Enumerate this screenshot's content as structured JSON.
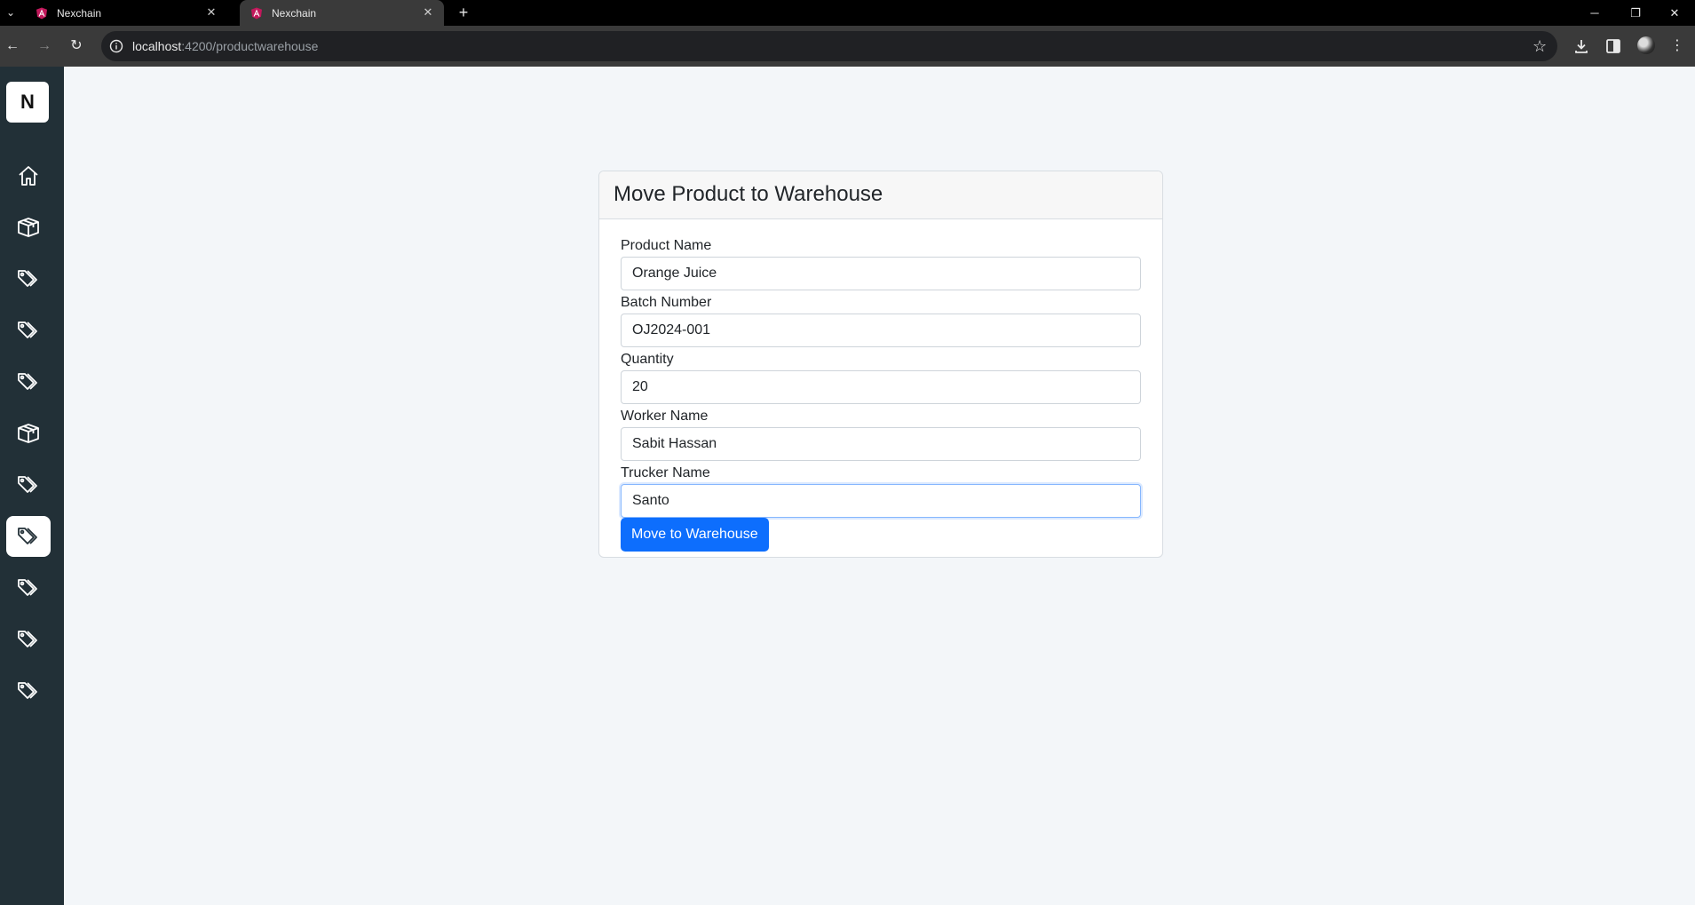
{
  "browser": {
    "tabs": [
      {
        "title": "Nexchain",
        "active": false
      },
      {
        "title": "Nexchain",
        "active": true
      }
    ],
    "url_host": "localhost",
    "url_path": ":4200/productwarehouse"
  },
  "sidebar": {
    "logo": "N",
    "items": [
      {
        "icon": "home-icon",
        "active": false
      },
      {
        "icon": "box-icon",
        "active": false
      },
      {
        "icon": "tag-icon",
        "active": false
      },
      {
        "icon": "tag-icon",
        "active": false
      },
      {
        "icon": "tag-icon",
        "active": false
      },
      {
        "icon": "box-icon",
        "active": false
      },
      {
        "icon": "tag-icon",
        "active": false
      },
      {
        "icon": "tag-icon",
        "active": true
      },
      {
        "icon": "tag-icon",
        "active": false
      },
      {
        "icon": "tag-icon",
        "active": false
      },
      {
        "icon": "tag-icon",
        "active": false
      }
    ]
  },
  "form": {
    "title": "Move Product to Warehouse",
    "fields": [
      {
        "label": "Product Name",
        "value": "Orange Juice"
      },
      {
        "label": "Batch Number",
        "value": "OJ2024-001"
      },
      {
        "label": "Quantity",
        "value": "20"
      },
      {
        "label": "Worker Name",
        "value": "Sabit Hassan"
      },
      {
        "label": "Trucker Name",
        "value": "Santo"
      }
    ],
    "submit_label": "Move to Warehouse"
  },
  "colors": {
    "primary": "#0d6efd",
    "sidebar_bg": "#223037",
    "page_bg": "#f3f6f9"
  }
}
